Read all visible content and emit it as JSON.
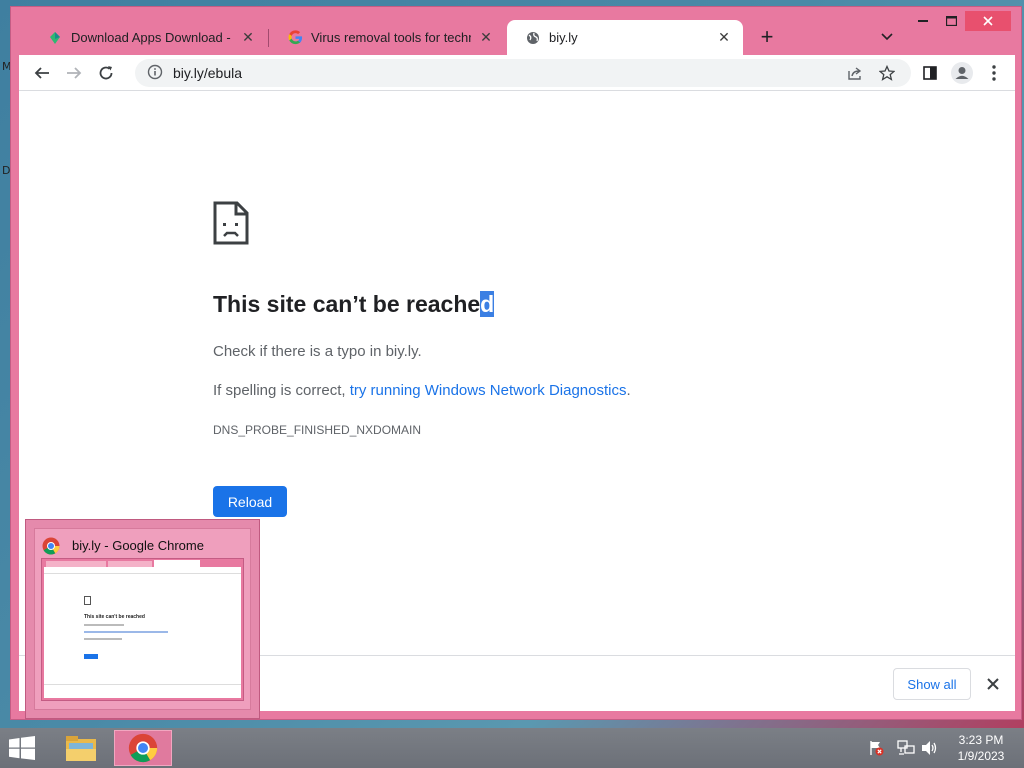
{
  "desktop": {
    "edge_letters": [
      "M",
      "D"
    ]
  },
  "browser": {
    "tabs": [
      {
        "title": "Download Apps Download - Bes",
        "favicon": "green-leaf-icon"
      },
      {
        "title": "Virus removal tools for technicia",
        "favicon": "google-icon"
      },
      {
        "title": "biy.ly",
        "favicon": "globe-icon"
      }
    ],
    "new_tab_label": "+",
    "address": {
      "url": "biy.ly/ebula"
    }
  },
  "error_page": {
    "title_main": "This site can’t be reache",
    "title_selected": "d",
    "line1": "Check if there is a typo in biy.ly.",
    "line2_prefix": "If spelling is correct, ",
    "line2_link": "try running Windows Network Diagnostics",
    "line2_suffix": ".",
    "error_code": "DNS_PROBE_FINISHED_NXDOMAIN",
    "reload_label": "Reload"
  },
  "download_bar": {
    "show_all_label": "Show all"
  },
  "thumbnail": {
    "window_title": "biy.ly - Google Chrome",
    "mini_title": "This site can't be reached"
  },
  "taskbar": {
    "time": "3:23 PM",
    "date": "1/9/2023"
  },
  "colors": {
    "frame": "#e879a0",
    "accent": "#1a73e8",
    "selection": "#3b7fe3"
  }
}
